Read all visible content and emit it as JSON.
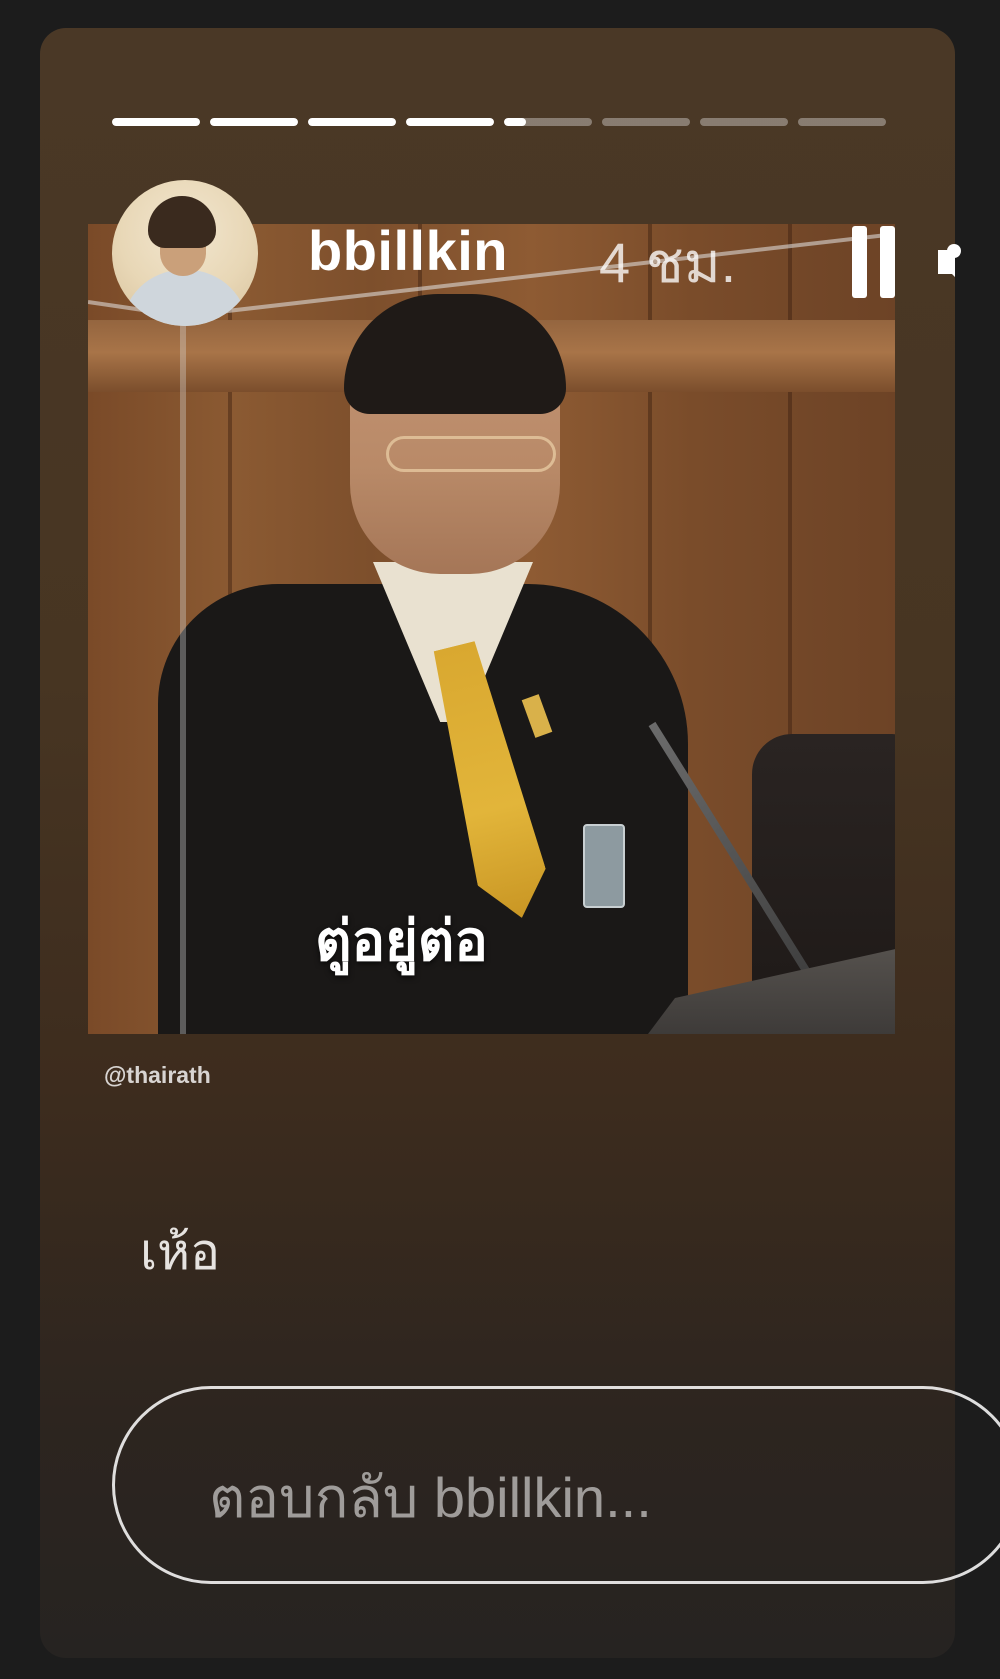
{
  "story": {
    "progress": {
      "segments": [
        {
          "fill": 1
        },
        {
          "fill": 1
        },
        {
          "fill": 1
        },
        {
          "fill": 1
        },
        {
          "fill": 0.25
        },
        {
          "fill": 0
        },
        {
          "fill": 0
        },
        {
          "fill": 0
        }
      ]
    },
    "header": {
      "username": "bbillkin",
      "time": "4 ชม."
    },
    "image": {
      "caption": "ตู่อยู่ต่อ",
      "source": "@thairath"
    },
    "text": "เห้อ",
    "reply": {
      "placeholder": "ตอบกลับ bbillkin..."
    }
  },
  "icons": {
    "pause": "pause-icon",
    "mute": "speaker-muted-icon",
    "more": "more-dots-icon"
  }
}
